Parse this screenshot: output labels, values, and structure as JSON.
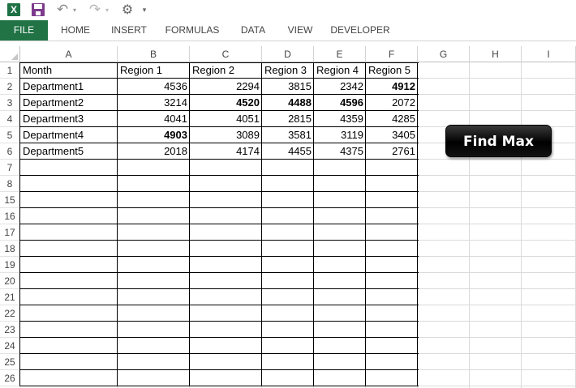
{
  "app": {
    "name": "Excel"
  },
  "qat": {
    "excel_icon": "X",
    "icons": [
      "excel-icon",
      "save-icon",
      "undo-icon",
      "redo-icon",
      "macro-icon",
      "customize-toolbar-icon"
    ]
  },
  "ribbon": {
    "tabs": [
      "FILE",
      "HOME",
      "INSERT",
      "FORMULAS",
      "DATA",
      "VIEW",
      "DEVELOPER"
    ],
    "active_color": "#217346"
  },
  "columns": [
    "A",
    "B",
    "C",
    "D",
    "E",
    "F",
    "G",
    "H",
    "I"
  ],
  "row_numbers": [
    "1",
    "2",
    "3",
    "4",
    "5",
    "6",
    "7",
    "8",
    "15",
    "16",
    "17",
    "18",
    "19",
    "20",
    "21",
    "22",
    "23",
    "24",
    "25",
    "26"
  ],
  "table": {
    "header": [
      "Month",
      "Region 1",
      "Region 2",
      "Region 3",
      "Region 4",
      "Region 5"
    ],
    "rows": [
      {
        "dept": "Department1",
        "values": [
          "4536",
          "2294",
          "3815",
          "2342",
          "4912"
        ]
      },
      {
        "dept": "Department2",
        "values": [
          "3214",
          "4520",
          "4488",
          "4596",
          "2072"
        ]
      },
      {
        "dept": "Department3",
        "values": [
          "4041",
          "4051",
          "2815",
          "4359",
          "4285"
        ]
      },
      {
        "dept": "Department4",
        "values": [
          "4903",
          "3089",
          "3581",
          "3119",
          "3405"
        ]
      },
      {
        "dept": "Department5",
        "values": [
          "2018",
          "4174",
          "4455",
          "4375",
          "2761"
        ]
      }
    ]
  },
  "button": {
    "label": "Find Max"
  }
}
